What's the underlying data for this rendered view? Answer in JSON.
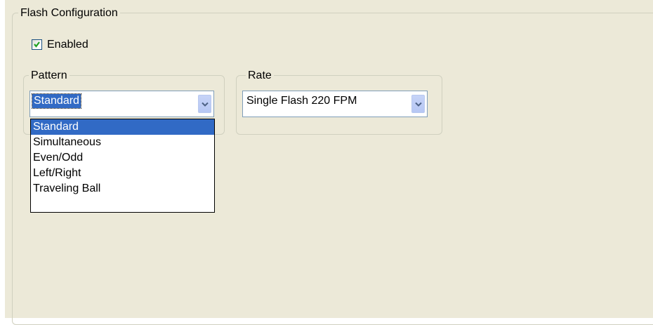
{
  "flash_config": {
    "title": "Flash Configuration",
    "enabled_label": "Enabled",
    "enabled_checked": true
  },
  "pattern": {
    "title": "Pattern",
    "selected": "Standard",
    "options": [
      "Standard",
      "Simultaneous",
      "Even/Odd",
      "Left/Right",
      "Traveling Ball"
    ],
    "highlighted_index": 0
  },
  "rate": {
    "title": "Rate",
    "selected": "Single Flash 220 FPM"
  },
  "colors": {
    "selection": "#316ac5",
    "panel_bg": "#ece9d8",
    "check": "#21a121"
  }
}
